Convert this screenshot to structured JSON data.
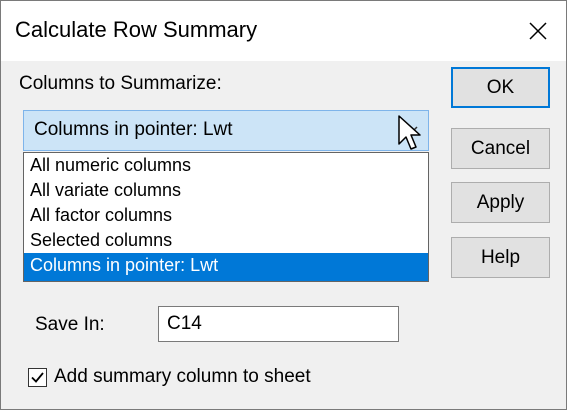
{
  "window": {
    "title": "Calculate Row Summary",
    "close_icon": "close-x-icon"
  },
  "columns_label": "Columns to Summarize:",
  "combo": {
    "selected_value": "Columns in pointer: Lwt",
    "arrow_icon": "chevron-down-icon"
  },
  "dropdown": {
    "options": [
      "All numeric columns",
      "All variate columns",
      "All factor columns",
      "Selected columns",
      "Columns in pointer: Lwt"
    ],
    "selected_index": 4
  },
  "buttons": {
    "ok": "OK",
    "cancel": "Cancel",
    "apply": "Apply",
    "help": "Help"
  },
  "save_in": {
    "label": "Save In:",
    "value": "C14"
  },
  "add_summary": {
    "label": "Add summary column to sheet",
    "checked": true
  },
  "colors": {
    "accent": "#0078d7",
    "combo_background": "#cce4f7",
    "dialog_background": "#f0f0f0"
  }
}
